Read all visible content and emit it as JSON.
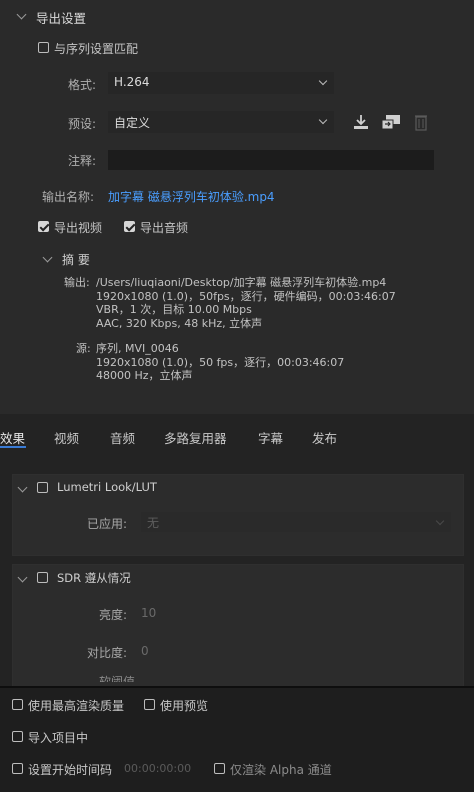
{
  "export_settings": {
    "header": "导出设置",
    "match_sequence_label": "与序列设置匹配",
    "format_label": "格式:",
    "format_value": "H.264",
    "preset_label": "预设:",
    "preset_value": "自定义",
    "comment_label": "注释:",
    "comment_value": "",
    "output_name_label": "输出名称:",
    "output_name_value": "加字幕 磁悬浮列车初体验.mp4",
    "export_video_label": "导出视频",
    "export_audio_label": "导出音频",
    "summary_header": "摘 要",
    "summary_output_label": "输出:",
    "summary_output_lines": [
      "/Users/liuqiaoni/Desktop/加字幕 磁悬浮列车初体验.mp4",
      "1920x1080 (1.0)，50fps，逐行，硬件编码，00:03:46:07",
      "VBR，1 次，目标 10.00 Mbps",
      "AAC, 320 Kbps, 48  kHz, 立体声"
    ],
    "summary_source_label": "源:",
    "summary_source_lines": [
      "序列, MVI_0046",
      "1920x1080 (1.0)，50 fps，逐行，00:03:46:07",
      "48000 Hz，立体声"
    ]
  },
  "tabs": [
    "效果",
    "视频",
    "音频",
    "多路复用器",
    "字幕",
    "发布"
  ],
  "effects": {
    "lumetri_label": "Lumetri Look/LUT",
    "applied_label": "已应用:",
    "applied_value": "无",
    "sdr_label": "SDR 遵从情况",
    "brightness_label": "亮度:",
    "brightness_value": "10",
    "contrast_label": "对比度:",
    "contrast_value": "0",
    "partial_label": "软阈值"
  },
  "bottom": {
    "max_render_quality": "使用最高渲染质量",
    "use_previews": "使用预览",
    "import_into_project": "导入项目中",
    "set_start_timecode": "设置开始时间码",
    "start_timecode_value": "00:00:00:00",
    "render_alpha_only": "仅渲染 Alpha 通道"
  },
  "colors": {
    "accent": "#3a7bd5",
    "link": "#4a9eff",
    "background": "#232323"
  },
  "icons": {
    "save_preset": "save-preset-icon",
    "import_preset": "import-preset-icon",
    "delete_preset": "trash-icon"
  }
}
